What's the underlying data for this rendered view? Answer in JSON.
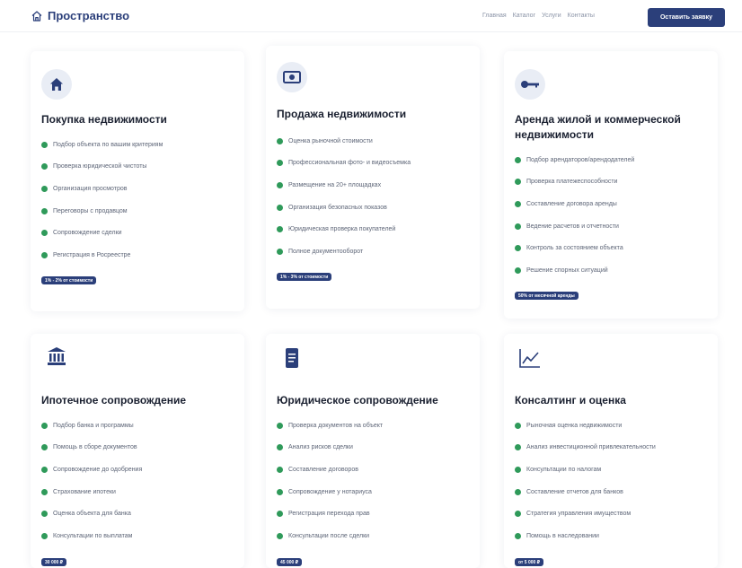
{
  "header": {
    "logo_text": "Пространство",
    "nav": [
      "Главная",
      "Каталог",
      "Услуги",
      "Контакты"
    ],
    "cta_label": "Оставить заявку"
  },
  "colors": {
    "primary": "#2b3f7a",
    "bullet": "#2f9a5a",
    "icon_bg": "#e9edf5"
  },
  "services": [
    {
      "icon": "house-icon",
      "title": "Покупка недвижимости",
      "features": [
        "Подбор объекта по вашим критериям",
        "Проверка юридической чистоты",
        "Организация просмотров",
        "Переговоры с продавцом",
        "Сопровождение сделки",
        "Регистрация в Росреестре"
      ],
      "price": "1% - 2% от стоимости"
    },
    {
      "icon": "cash-icon",
      "title": "Продажа недвижимости",
      "features": [
        "Оценка рыночной стоимости",
        "Профессиональная фото- и видеосъемка",
        "Размещение на 20+ площадках",
        "Организация безопасных показов",
        "Юридическая проверка покупателей",
        "Полное документооборот"
      ],
      "price": "1% - 3% от стоимости"
    },
    {
      "icon": "key-icon",
      "title": "Аренда жилой и коммерческой недвижимости",
      "features": [
        "Подбор арендаторов/арендодателей",
        "Проверка платежеспособности",
        "Составление договора аренды",
        "Ведение расчетов и отчетности",
        "Контроль за состоянием объекта",
        "Решение спорных ситуаций"
      ],
      "price": "50% от месячной аренды"
    },
    {
      "icon": "bank-icon",
      "title": "Ипотечное сопровождение",
      "features": [
        "Подбор банка и программы",
        "Помощь в сборе документов",
        "Сопровождение до одобрения",
        "Страхование ипотеки",
        "Оценка объекта для банка",
        "Консультации по выплатам"
      ],
      "price": "30 000 ₽"
    },
    {
      "icon": "document-icon",
      "title": "Юридическое сопровождение",
      "features": [
        "Проверка документов на объект",
        "Анализ рисков сделки",
        "Составление договоров",
        "Сопровождение у нотариуса",
        "Регистрация перехода прав",
        "Консультации после сделки"
      ],
      "price": "45 000 ₽"
    },
    {
      "icon": "chart-line-icon",
      "title": "Консалтинг и оценка",
      "features": [
        "Рыночная оценка недвижимости",
        "Анализ инвестиционной привлекательности",
        "Консультации по налогам",
        "Составление отчетов для банков",
        "Стратегия управления имуществом",
        "Помощь в наследовании"
      ],
      "price": "от 5 000 ₽"
    }
  ]
}
